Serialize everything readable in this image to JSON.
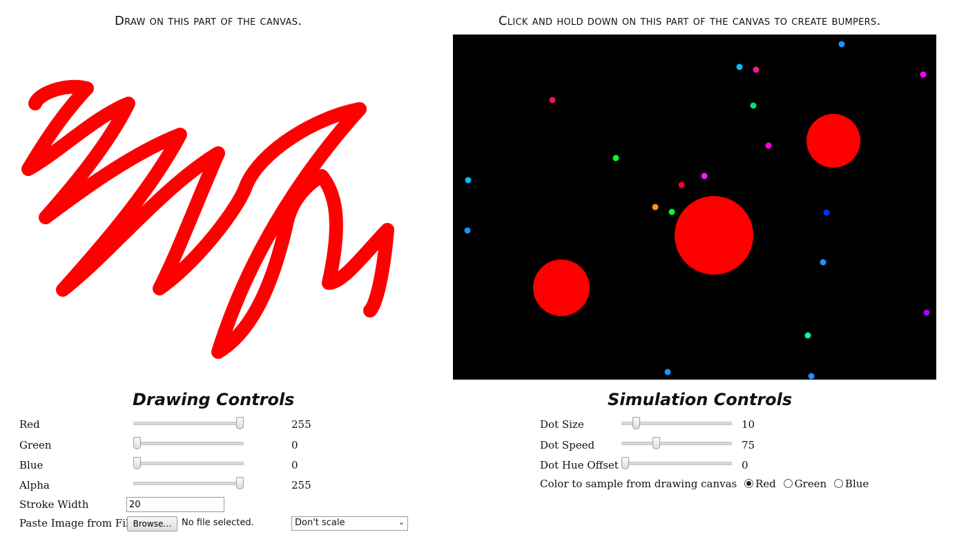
{
  "drawing_canvas": {
    "heading": "Draw on this part of the canvas.",
    "stroke_color": "#ff0000"
  },
  "simulation_canvas": {
    "heading": "Click and hold down on this part of the canvas to create bumpers.",
    "background": "#000000",
    "bumper_color": "#ff0000"
  },
  "drawing_controls": {
    "title": "Drawing Controls",
    "sliders": [
      {
        "label": "Red",
        "value": "255",
        "fraction": 0.96
      },
      {
        "label": "Green",
        "value": "0",
        "fraction": 0.03
      },
      {
        "label": "Blue",
        "value": "0",
        "fraction": 0.03
      },
      {
        "label": "Alpha",
        "value": "255",
        "fraction": 0.96
      }
    ],
    "stroke_width": {
      "label": "Stroke Width",
      "value": "20"
    },
    "paste_image": {
      "label": "Paste Image from File",
      "browse_label": "Browse…",
      "file_status": "No file selected.",
      "scale_selected": "Don't scale"
    }
  },
  "simulation_controls": {
    "title": "Simulation Controls",
    "sliders": [
      {
        "label": "Dot Size",
        "value": "10",
        "fraction": 0.13
      },
      {
        "label": "Dot Speed",
        "value": "75",
        "fraction": 0.31
      },
      {
        "label": "Dot Hue Offset",
        "value": "0",
        "fraction": 0.03
      }
    ],
    "color_sample": {
      "label": "Color to sample from drawing canvas",
      "options": [
        "Red",
        "Green",
        "Blue"
      ],
      "selected": "Red"
    }
  },
  "icons": {
    "select_arrow": "chevron-down-icon"
  }
}
